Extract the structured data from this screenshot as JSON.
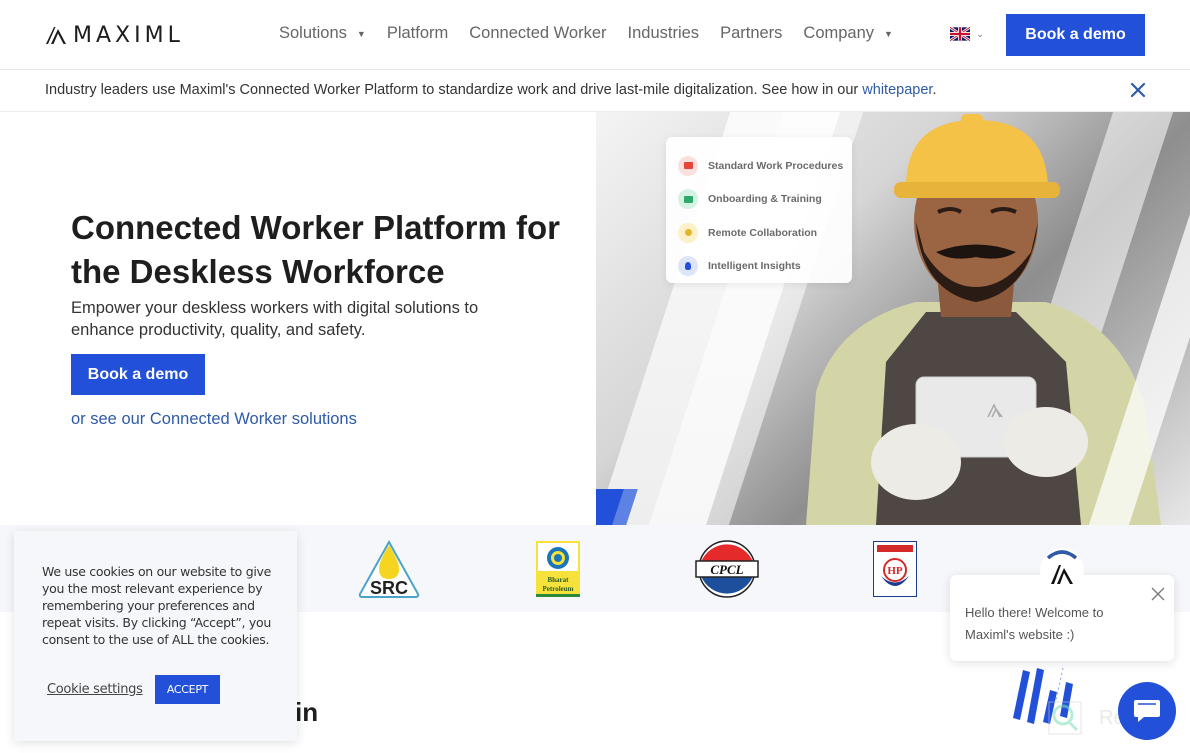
{
  "header": {
    "logo_text": "MAXIML",
    "nav": [
      {
        "label": "Solutions",
        "has_dropdown": true
      },
      {
        "label": "Platform",
        "has_dropdown": false
      },
      {
        "label": "Connected Worker",
        "has_dropdown": false
      },
      {
        "label": "Industries",
        "has_dropdown": false
      },
      {
        "label": "Partners",
        "has_dropdown": false
      },
      {
        "label": "Company",
        "has_dropdown": true
      }
    ],
    "language_icon": "uk-flag-icon",
    "cta_label": "Book a demo"
  },
  "announcement": {
    "text": "Industry leaders use Maximl's Connected Worker Platform to standardize work and drive last-mile digitalization. See how in our ",
    "link_label": "whitepaper",
    "suffix": "."
  },
  "hero": {
    "title": "Connected Worker Platform for the Deskless Workforce",
    "subtitle": "Empower your deskless workers with digital solutions to enhance productivity, quality, and safety.",
    "cta_label": "Book a demo",
    "link_prefix": "or see our ",
    "link_label": "Connected Worker solutions",
    "features": [
      {
        "label": "Standard Work Procedures",
        "icon": "briefcase-icon",
        "color": "#e4463a",
        "bg": "#fbe0dd"
      },
      {
        "label": "Onboarding & Training",
        "icon": "presentation-icon",
        "color": "#2ea86b",
        "bg": "#d5f2e3"
      },
      {
        "label": "Remote Collaboration",
        "icon": "network-icon",
        "color": "#e5b62a",
        "bg": "#fcf1c8"
      },
      {
        "label": "Intelligent Insights",
        "icon": "lightbulb-icon",
        "color": "#2350d9",
        "bg": "#dfe5f8"
      }
    ]
  },
  "clients": [
    {
      "name": "SRC"
    },
    {
      "name": "Bharat Petroleum",
      "line1": "Bharat",
      "line2": "Petroleum"
    },
    {
      "name": "CPCL"
    },
    {
      "name": "HP"
    }
  ],
  "cookie": {
    "text": "We use cookies on our website to give you the most relevant experience by remembering your preferences and repeat visits. By clicking “Accept”, you consent to the use of ALL the cookies.",
    "settings_label": "Cookie settings",
    "accept_label": "ACCEPT"
  },
  "section_heading_fragment": "in",
  "chat": {
    "greeting_line1": "Hello there! Welcome to",
    "greeting_line2": "Maximl's website :)"
  },
  "watermark": "Revain",
  "colors": {
    "brand_blue": "#2350d9",
    "link_blue": "#2e5aa8"
  }
}
